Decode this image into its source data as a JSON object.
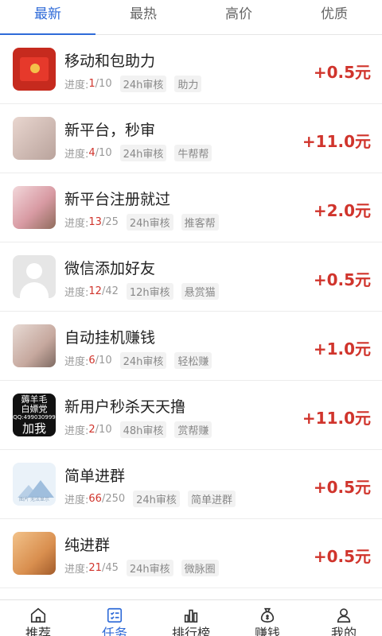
{
  "tabs": [
    "最新",
    "最热",
    "高价",
    "优质"
  ],
  "tasks": [
    {
      "title": "移动和包助力",
      "progress_label": "进度:",
      "current": "1",
      "total": "/10",
      "review": "24h审核",
      "source": "助力",
      "reward": "+0.5元"
    },
    {
      "title": "新平台，秒审",
      "progress_label": "进度:",
      "current": "4",
      "total": "/10",
      "review": "24h审核",
      "source": "牛帮帮",
      "reward": "+11.0元"
    },
    {
      "title": "新平台注册就过",
      "progress_label": "进度:",
      "current": "13",
      "total": "/25",
      "review": "24h审核",
      "source": "推客帮",
      "reward": "+2.0元"
    },
    {
      "title": "微信添加好友",
      "progress_label": "进度:",
      "current": "12",
      "total": "/42",
      "review": "12h审核",
      "source": "悬赏猫",
      "reward": "+0.5元"
    },
    {
      "title": "自动挂机赚钱",
      "progress_label": "进度:",
      "current": "6",
      "total": "/10",
      "review": "24h审核",
      "source": "轻松赚",
      "reward": "+1.0元"
    },
    {
      "title": "新用户秒杀天天撸",
      "progress_label": "进度:",
      "current": "2",
      "total": "/10",
      "review": "48h审核",
      "source": "赏帮赚",
      "reward": "+11.0元",
      "thumb_text": [
        "薅羊毛",
        "白嫖党",
        "QQ:499030999",
        "加我"
      ]
    },
    {
      "title": "简单进群",
      "progress_label": "进度:",
      "current": "66",
      "total": "/250",
      "review": "24h审核",
      "source": "简单进群",
      "reward": "+0.5元",
      "thumb_caption": "图片 无法显示"
    },
    {
      "title": "纯进群",
      "progress_label": "进度:",
      "current": "21",
      "total": "/45",
      "review": "24h审核",
      "source": "微脉圈",
      "reward": "+0.5元"
    }
  ],
  "bottom_nav": [
    {
      "label": "推荐",
      "icon": "home-icon"
    },
    {
      "label": "任务",
      "icon": "task-list-icon"
    },
    {
      "label": "排行榜",
      "icon": "ranking-icon"
    },
    {
      "label": "赚钱",
      "icon": "money-bag-icon"
    },
    {
      "label": "我的",
      "icon": "user-icon"
    }
  ],
  "colors": {
    "accent": "#2f6bd8",
    "reward": "#d0342c"
  }
}
